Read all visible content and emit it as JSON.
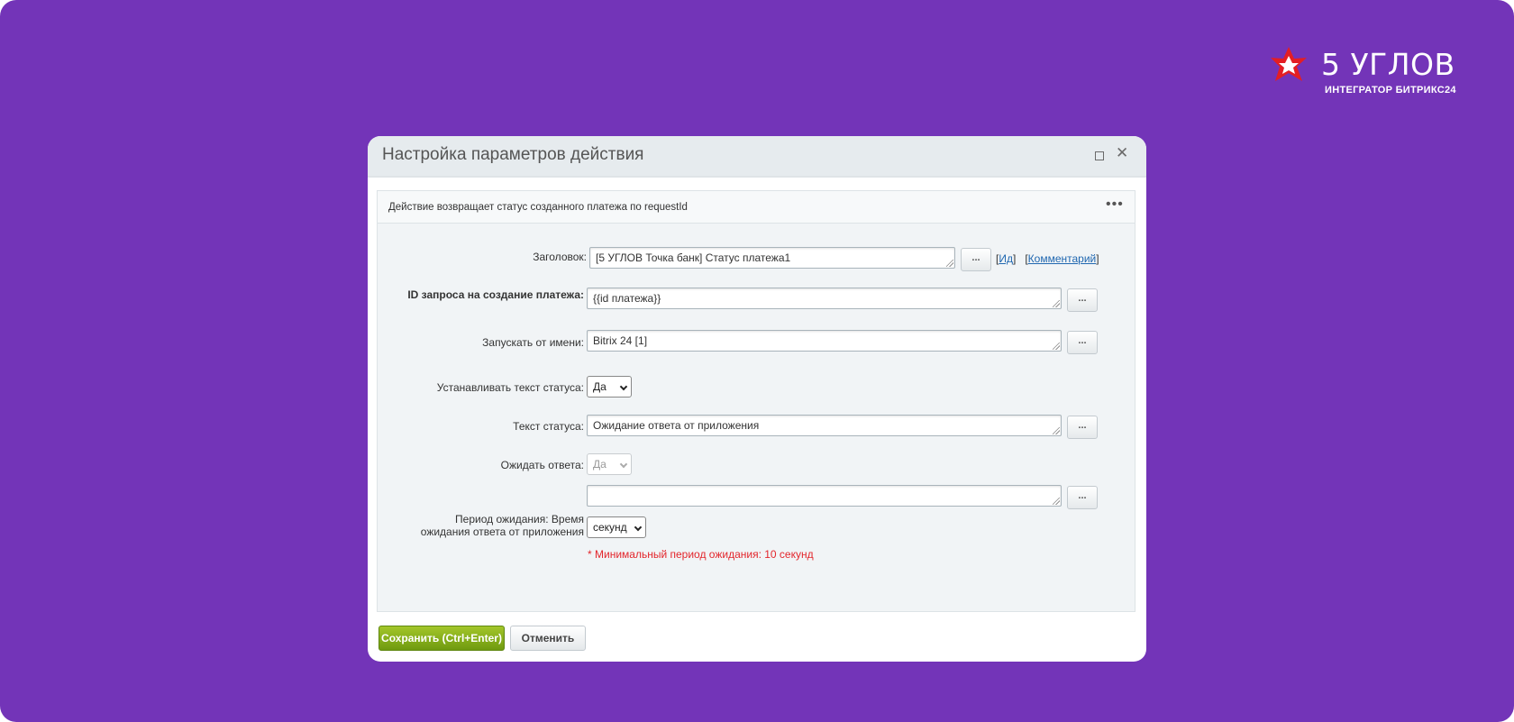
{
  "brand": {
    "name": "5 УГЛОВ",
    "subtitle": "ИНТЕГРАТОР БИТРИКС24",
    "mark_color": "#e31e24"
  },
  "dialog": {
    "title": "Настройка параметров действия",
    "description": "Действие возвращает статус созданного платежа по requestId",
    "fields": {
      "title": {
        "label": "Заголовок:",
        "value": "[5 УГЛОВ Точка банк] Статус платежа1"
      },
      "request_id": {
        "label": "ID запроса на создание платежа:",
        "value": "{{id платежа}}"
      },
      "run_as": {
        "label": "Запускать от имени:",
        "value": "Bitrix 24 [1]"
      },
      "set_status_text": {
        "label": "Устанавливать текст статуса:",
        "value": "Да"
      },
      "status_text": {
        "label": "Текст статуса:",
        "value": "Ожидание ответа от приложения"
      },
      "wait_response": {
        "label": "Ожидать ответа:",
        "value": "Да"
      },
      "wait_period": {
        "label": "Период ожидания: Время ожидания ответа от приложения",
        "value": "",
        "unit": "секунд",
        "hint": "* Минимальный период ожидания: 10 секунд"
      }
    },
    "links": {
      "id": "Ид",
      "comment": "Комментарий"
    },
    "dots_label": "...",
    "buttons": {
      "save": "Сохранить (Ctrl+Enter)",
      "cancel": "Отменить"
    }
  },
  "colors": {
    "background": "#7334b8",
    "save_button": "#8bb31b",
    "hint": "#e3262c",
    "link": "#2067b0"
  }
}
